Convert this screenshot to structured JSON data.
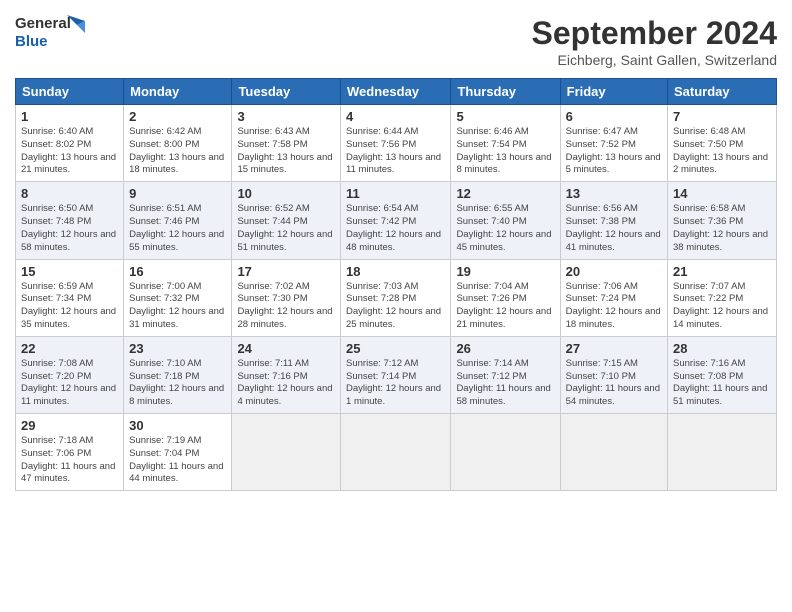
{
  "header": {
    "logo_general": "General",
    "logo_blue": "Blue",
    "month_title": "September 2024",
    "location": "Eichberg, Saint Gallen, Switzerland"
  },
  "calendar": {
    "days_of_week": [
      "Sunday",
      "Monday",
      "Tuesday",
      "Wednesday",
      "Thursday",
      "Friday",
      "Saturday"
    ],
    "weeks": [
      [
        {
          "day": "",
          "empty": true
        },
        {
          "day": "",
          "empty": true
        },
        {
          "day": "",
          "empty": true
        },
        {
          "day": "",
          "empty": true
        },
        {
          "day": "",
          "empty": true
        },
        {
          "day": "",
          "empty": true
        },
        {
          "day": "",
          "empty": true
        }
      ],
      [
        {
          "day": "1",
          "sunrise": "Sunrise: 6:40 AM",
          "sunset": "Sunset: 8:02 PM",
          "daylight": "Daylight: 13 hours and 21 minutes."
        },
        {
          "day": "2",
          "sunrise": "Sunrise: 6:42 AM",
          "sunset": "Sunset: 8:00 PM",
          "daylight": "Daylight: 13 hours and 18 minutes."
        },
        {
          "day": "3",
          "sunrise": "Sunrise: 6:43 AM",
          "sunset": "Sunset: 7:58 PM",
          "daylight": "Daylight: 13 hours and 15 minutes."
        },
        {
          "day": "4",
          "sunrise": "Sunrise: 6:44 AM",
          "sunset": "Sunset: 7:56 PM",
          "daylight": "Daylight: 13 hours and 11 minutes."
        },
        {
          "day": "5",
          "sunrise": "Sunrise: 6:46 AM",
          "sunset": "Sunset: 7:54 PM",
          "daylight": "Daylight: 13 hours and 8 minutes."
        },
        {
          "day": "6",
          "sunrise": "Sunrise: 6:47 AM",
          "sunset": "Sunset: 7:52 PM",
          "daylight": "Daylight: 13 hours and 5 minutes."
        },
        {
          "day": "7",
          "sunrise": "Sunrise: 6:48 AM",
          "sunset": "Sunset: 7:50 PM",
          "daylight": "Daylight: 13 hours and 2 minutes."
        }
      ],
      [
        {
          "day": "8",
          "sunrise": "Sunrise: 6:50 AM",
          "sunset": "Sunset: 7:48 PM",
          "daylight": "Daylight: 12 hours and 58 minutes."
        },
        {
          "day": "9",
          "sunrise": "Sunrise: 6:51 AM",
          "sunset": "Sunset: 7:46 PM",
          "daylight": "Daylight: 12 hours and 55 minutes."
        },
        {
          "day": "10",
          "sunrise": "Sunrise: 6:52 AM",
          "sunset": "Sunset: 7:44 PM",
          "daylight": "Daylight: 12 hours and 51 minutes."
        },
        {
          "day": "11",
          "sunrise": "Sunrise: 6:54 AM",
          "sunset": "Sunset: 7:42 PM",
          "daylight": "Daylight: 12 hours and 48 minutes."
        },
        {
          "day": "12",
          "sunrise": "Sunrise: 6:55 AM",
          "sunset": "Sunset: 7:40 PM",
          "daylight": "Daylight: 12 hours and 45 minutes."
        },
        {
          "day": "13",
          "sunrise": "Sunrise: 6:56 AM",
          "sunset": "Sunset: 7:38 PM",
          "daylight": "Daylight: 12 hours and 41 minutes."
        },
        {
          "day": "14",
          "sunrise": "Sunrise: 6:58 AM",
          "sunset": "Sunset: 7:36 PM",
          "daylight": "Daylight: 12 hours and 38 minutes."
        }
      ],
      [
        {
          "day": "15",
          "sunrise": "Sunrise: 6:59 AM",
          "sunset": "Sunset: 7:34 PM",
          "daylight": "Daylight: 12 hours and 35 minutes."
        },
        {
          "day": "16",
          "sunrise": "Sunrise: 7:00 AM",
          "sunset": "Sunset: 7:32 PM",
          "daylight": "Daylight: 12 hours and 31 minutes."
        },
        {
          "day": "17",
          "sunrise": "Sunrise: 7:02 AM",
          "sunset": "Sunset: 7:30 PM",
          "daylight": "Daylight: 12 hours and 28 minutes."
        },
        {
          "day": "18",
          "sunrise": "Sunrise: 7:03 AM",
          "sunset": "Sunset: 7:28 PM",
          "daylight": "Daylight: 12 hours and 25 minutes."
        },
        {
          "day": "19",
          "sunrise": "Sunrise: 7:04 AM",
          "sunset": "Sunset: 7:26 PM",
          "daylight": "Daylight: 12 hours and 21 minutes."
        },
        {
          "day": "20",
          "sunrise": "Sunrise: 7:06 AM",
          "sunset": "Sunset: 7:24 PM",
          "daylight": "Daylight: 12 hours and 18 minutes."
        },
        {
          "day": "21",
          "sunrise": "Sunrise: 7:07 AM",
          "sunset": "Sunset: 7:22 PM",
          "daylight": "Daylight: 12 hours and 14 minutes."
        }
      ],
      [
        {
          "day": "22",
          "sunrise": "Sunrise: 7:08 AM",
          "sunset": "Sunset: 7:20 PM",
          "daylight": "Daylight: 12 hours and 11 minutes."
        },
        {
          "day": "23",
          "sunrise": "Sunrise: 7:10 AM",
          "sunset": "Sunset: 7:18 PM",
          "daylight": "Daylight: 12 hours and 8 minutes."
        },
        {
          "day": "24",
          "sunrise": "Sunrise: 7:11 AM",
          "sunset": "Sunset: 7:16 PM",
          "daylight": "Daylight: 12 hours and 4 minutes."
        },
        {
          "day": "25",
          "sunrise": "Sunrise: 7:12 AM",
          "sunset": "Sunset: 7:14 PM",
          "daylight": "Daylight: 12 hours and 1 minute."
        },
        {
          "day": "26",
          "sunrise": "Sunrise: 7:14 AM",
          "sunset": "Sunset: 7:12 PM",
          "daylight": "Daylight: 11 hours and 58 minutes."
        },
        {
          "day": "27",
          "sunrise": "Sunrise: 7:15 AM",
          "sunset": "Sunset: 7:10 PM",
          "daylight": "Daylight: 11 hours and 54 minutes."
        },
        {
          "day": "28",
          "sunrise": "Sunrise: 7:16 AM",
          "sunset": "Sunset: 7:08 PM",
          "daylight": "Daylight: 11 hours and 51 minutes."
        }
      ],
      [
        {
          "day": "29",
          "sunrise": "Sunrise: 7:18 AM",
          "sunset": "Sunset: 7:06 PM",
          "daylight": "Daylight: 11 hours and 47 minutes."
        },
        {
          "day": "30",
          "sunrise": "Sunrise: 7:19 AM",
          "sunset": "Sunset: 7:04 PM",
          "daylight": "Daylight: 11 hours and 44 minutes."
        },
        {
          "day": "",
          "empty": true
        },
        {
          "day": "",
          "empty": true
        },
        {
          "day": "",
          "empty": true
        },
        {
          "day": "",
          "empty": true
        },
        {
          "day": "",
          "empty": true
        }
      ]
    ]
  }
}
